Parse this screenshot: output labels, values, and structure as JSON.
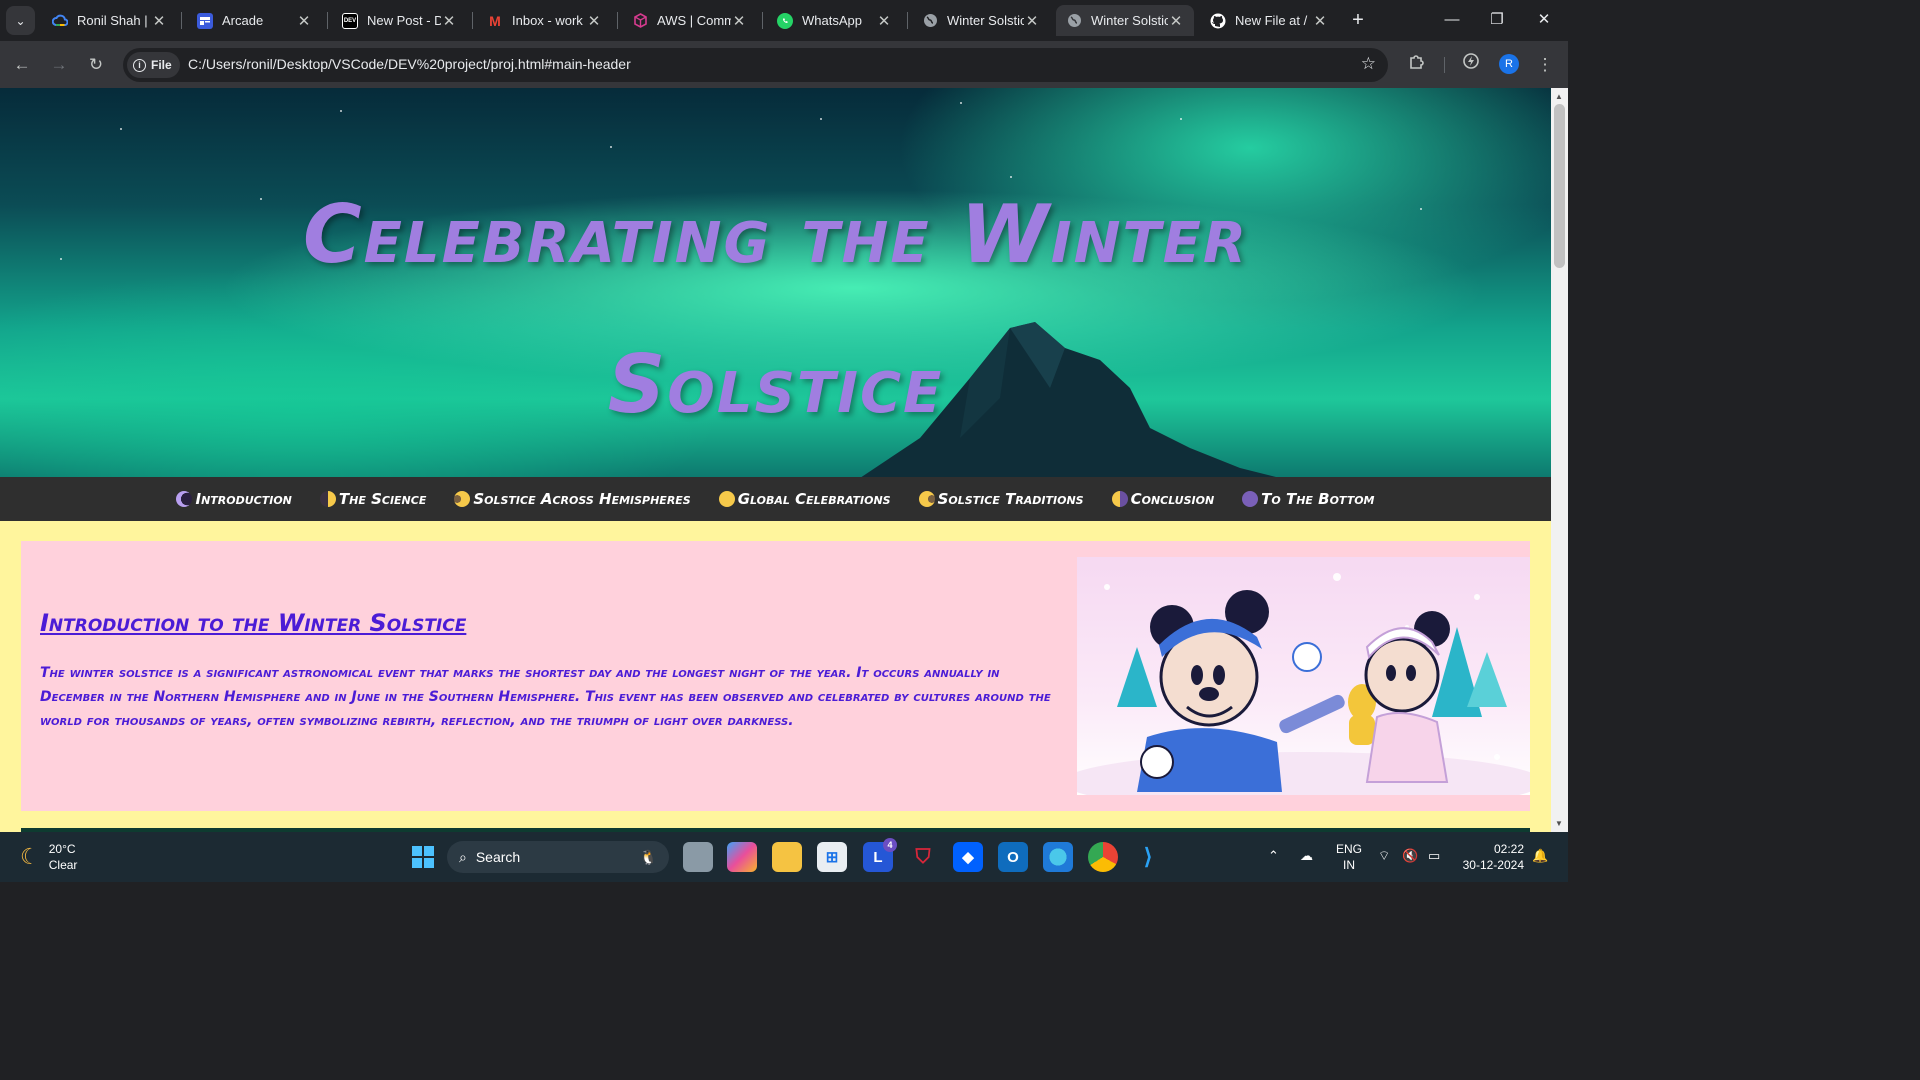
{
  "browser": {
    "tabs": [
      {
        "title": "Ronil Shah | G",
        "icon": "google-cloud-icon",
        "active": false
      },
      {
        "title": "Arcade",
        "icon": "arcade-icon",
        "active": false
      },
      {
        "title": "New Post - D",
        "icon": "dev-icon",
        "icon_text": "DEV",
        "active": false
      },
      {
        "title": "Inbox - work",
        "icon": "gmail-icon",
        "icon_text": "M",
        "active": false
      },
      {
        "title": "AWS | Comm",
        "icon": "aws-cube-icon",
        "active": false
      },
      {
        "title": "WhatsApp",
        "icon": "whatsapp-icon",
        "active": false
      },
      {
        "title": "Winter Solstic",
        "icon": "globe-icon",
        "active": false
      },
      {
        "title": "Winter Solstic",
        "icon": "globe-icon",
        "active": true
      },
      {
        "title": "New File at /",
        "icon": "github-icon",
        "active": false
      }
    ],
    "close_glyph": "✕",
    "new_tab_glyph": "+",
    "address": {
      "chip_label": "File",
      "url": "C:/Users/ronil/Desktop/VSCode/DEV%20project/proj.html#main-header"
    },
    "profile_initial": "R"
  },
  "page": {
    "hero_title": "Celebrating the Winter Solstice",
    "nav": [
      {
        "label": "Introduction",
        "moon": "waning-crescent"
      },
      {
        "label": "The Science",
        "moon": "first-quarter"
      },
      {
        "label": "Solstice Across Hemispheres",
        "moon": "waxing-gibbous"
      },
      {
        "label": "Global Celebrations",
        "moon": "full"
      },
      {
        "label": "Solstice Traditions",
        "moon": "waning-gibbous"
      },
      {
        "label": "Conclusion",
        "moon": "last-quarter"
      },
      {
        "label": "To The Bottom",
        "moon": "new"
      }
    ],
    "intro": {
      "heading": "Introduction to the Winter Solstice",
      "body": "The winter solstice is a significant astronomical event that marks the shortest day and the longest night of the year. It occurs annually in December in the Northern Hemisphere and in June in the Southern Hemisphere. This event has been observed and celebrated by cultures around the world for thousands of years, often symbolizing rebirth, reflection, and the triumph of light over darkness.",
      "image": "mickey-minnie-winter-illustration"
    },
    "colors": {
      "background": "#fff59d",
      "card": "#ffd1dc",
      "title": "#a07ee0",
      "text": "#4b1cd6",
      "navbar": "#2f2f2f"
    }
  },
  "taskbar": {
    "weather": {
      "temp": "20°C",
      "condition": "Clear"
    },
    "search_label": "Search",
    "app_badge": "4",
    "lang": {
      "line1": "ENG",
      "line2": "IN"
    },
    "clock": {
      "time": "02:22",
      "date": "30-12-2024"
    }
  }
}
